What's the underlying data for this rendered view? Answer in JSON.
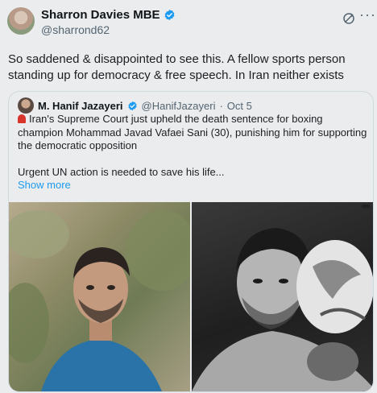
{
  "author": {
    "name": "Sharron Davies MBE",
    "handle": "@sharrond62"
  },
  "tweet": {
    "text": "So saddened & disappointed to see this. A fellow sports person standing up for democracy & free speech. In Iran neither exists"
  },
  "quoted": {
    "name": "M. Hanif Jazayeri",
    "handle": "@HanifJazayeri",
    "dot": "·",
    "date": "Oct 5",
    "text": "Iran's Supreme Court just upheld the death sentence for boxing champion Mohammad Javad Vafaei Sani (30), punishing him for supporting the democratic opposition",
    "text2": "Urgent UN action is needed to save his life...",
    "show_more": "Show more"
  },
  "colors": {
    "verified": "#1d9bf0",
    "link": "#1d9bf0",
    "background": "#ebeced"
  },
  "icons": [
    "verified-badge-icon",
    "grok-icon",
    "more-icon",
    "siren-icon"
  ]
}
